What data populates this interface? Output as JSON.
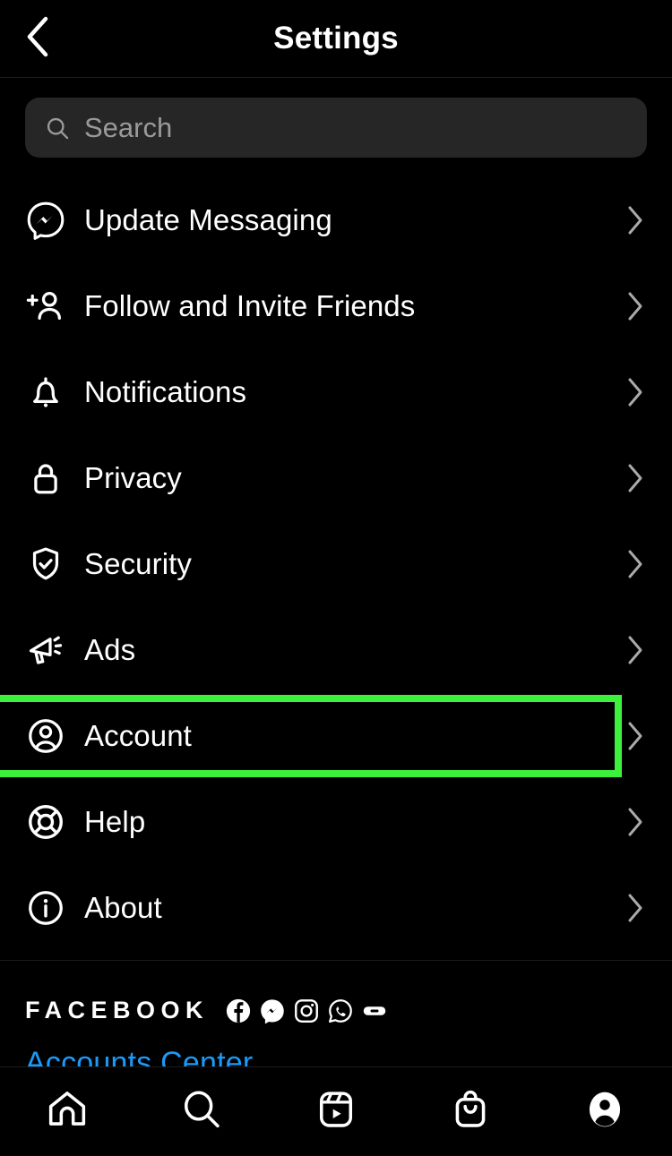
{
  "header": {
    "title": "Settings",
    "back_icon": "chevron-left-icon"
  },
  "search": {
    "placeholder": "Search",
    "value": "",
    "icon": "search-icon"
  },
  "menu": {
    "items": [
      {
        "label": "Update Messaging",
        "icon": "messenger-icon",
        "chevron": "chevron-right-icon",
        "highlighted": false
      },
      {
        "label": "Follow and Invite Friends",
        "icon": "person-add-icon",
        "chevron": "chevron-right-icon",
        "highlighted": false
      },
      {
        "label": "Notifications",
        "icon": "bell-icon",
        "chevron": "chevron-right-icon",
        "highlighted": false
      },
      {
        "label": "Privacy",
        "icon": "lock-icon",
        "chevron": "chevron-right-icon",
        "highlighted": false
      },
      {
        "label": "Security",
        "icon": "shield-check-icon",
        "chevron": "chevron-right-icon",
        "highlighted": false
      },
      {
        "label": "Ads",
        "icon": "megaphone-icon",
        "chevron": "chevron-right-icon",
        "highlighted": false
      },
      {
        "label": "Account",
        "icon": "account-circle-icon",
        "chevron": "chevron-right-icon",
        "highlighted": true
      },
      {
        "label": "Help",
        "icon": "lifebuoy-icon",
        "chevron": "chevron-right-icon",
        "highlighted": false
      },
      {
        "label": "About",
        "icon": "info-circle-icon",
        "chevron": "chevron-right-icon",
        "highlighted": false
      }
    ]
  },
  "footer": {
    "brand_word": "FACEBOOK",
    "brand_icons": [
      "facebook-icon",
      "messenger-icon",
      "instagram-icon",
      "whatsapp-icon",
      "oculus-icon"
    ],
    "accounts_center_label": "Accounts Center"
  },
  "bottom_nav": {
    "items": [
      {
        "icon": "home-icon",
        "active": false
      },
      {
        "icon": "search-icon",
        "active": false
      },
      {
        "icon": "reels-icon",
        "active": false
      },
      {
        "icon": "shop-bag-icon",
        "active": false
      },
      {
        "icon": "profile-avatar-icon",
        "active": true
      }
    ]
  },
  "colors": {
    "background": "#000000",
    "search_field": "#262626",
    "highlight": "#3cf03c",
    "link_blue": "#1a9bfc",
    "chevron": "#aaaaaa",
    "divider": "#1c1c1c"
  }
}
